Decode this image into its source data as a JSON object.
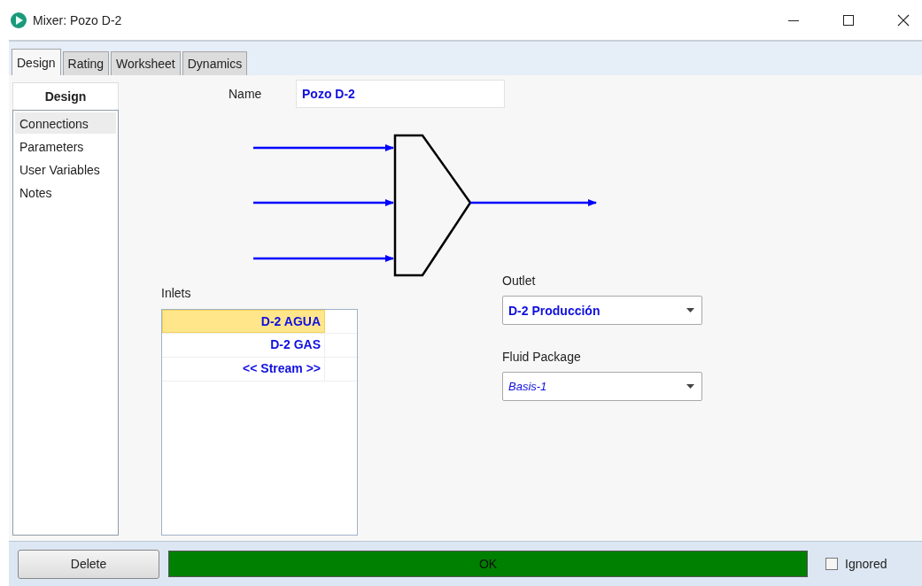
{
  "window": {
    "title": "Mixer: Pozo D-2"
  },
  "tabs": [
    {
      "label": "Design",
      "selected": true
    },
    {
      "label": "Rating",
      "selected": false
    },
    {
      "label": "Worksheet",
      "selected": false
    },
    {
      "label": "Dynamics",
      "selected": false
    }
  ],
  "sidebar": {
    "heading": "Design",
    "items": [
      {
        "label": "Connections",
        "selected": true
      },
      {
        "label": "Parameters",
        "selected": false
      },
      {
        "label": "User Variables",
        "selected": false
      },
      {
        "label": "Notes",
        "selected": false
      }
    ]
  },
  "name": {
    "label": "Name",
    "value": "Pozo D-2"
  },
  "inlets": {
    "label": "Inlets",
    "rows": [
      {
        "text": "D-2 AGUA",
        "selected": true
      },
      {
        "text": "D-2 GAS",
        "selected": false
      },
      {
        "text": "<< Stream >>",
        "selected": false
      }
    ]
  },
  "outlet": {
    "label": "Outlet",
    "value": "D-2 Producción"
  },
  "fluid_package": {
    "label": "Fluid Package",
    "value": "Basis-1"
  },
  "footer": {
    "delete": "Delete",
    "status": "OK",
    "ignored": {
      "label": "Ignored",
      "checked": false
    }
  }
}
